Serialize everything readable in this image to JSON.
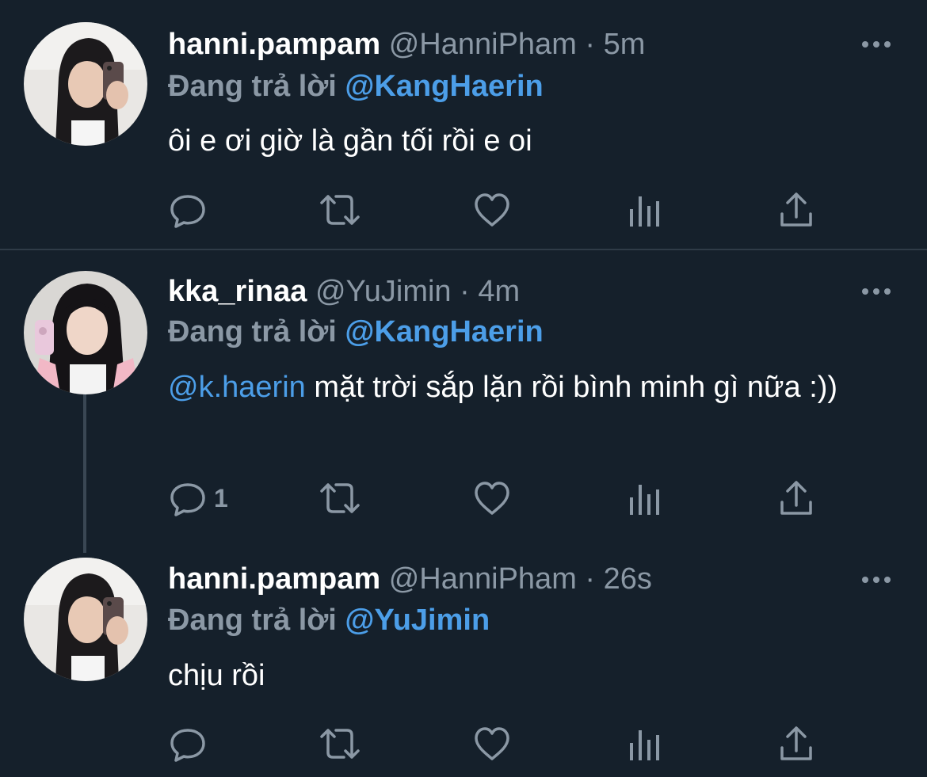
{
  "colors": {
    "background": "#15202b",
    "text": "#ffffff",
    "muted": "#8b98a5",
    "accent": "#4c9ee8",
    "divider": "#2f3b47"
  },
  "tweets": [
    {
      "name": "hanni.pampam",
      "handle": "@HanniPham",
      "separator": "·",
      "time": "5m",
      "replying_prefix": "Đang trả lời",
      "replying_to": "@KangHaerin",
      "mention": "",
      "text": "ôi e ơi giờ là gần tối rồi e oi",
      "reply_count": "",
      "icons": [
        "reply-icon",
        "retweet-icon",
        "like-icon",
        "analytics-icon",
        "share-icon",
        "more-icon"
      ]
    },
    {
      "name": "kka_rinaa",
      "handle": "@YuJimin",
      "separator": "·",
      "time": "4m",
      "replying_prefix": "Đang trả lời",
      "replying_to": "@KangHaerin",
      "mention": "@k.haerin",
      "text": " mặt trời sắp lặn rồi bình minh gì nữa :))",
      "reply_count": "1",
      "icons": [
        "reply-icon",
        "retweet-icon",
        "like-icon",
        "analytics-icon",
        "share-icon",
        "more-icon"
      ]
    },
    {
      "name": "hanni.pampam",
      "handle": "@HanniPham",
      "separator": "·",
      "time": "26s",
      "replying_prefix": "Đang trả lời",
      "replying_to": "@YuJimin",
      "mention": "",
      "text": "chịu rồi",
      "reply_count": "",
      "icons": [
        "reply-icon",
        "retweet-icon",
        "like-icon",
        "analytics-icon",
        "share-icon",
        "more-icon"
      ]
    }
  ]
}
